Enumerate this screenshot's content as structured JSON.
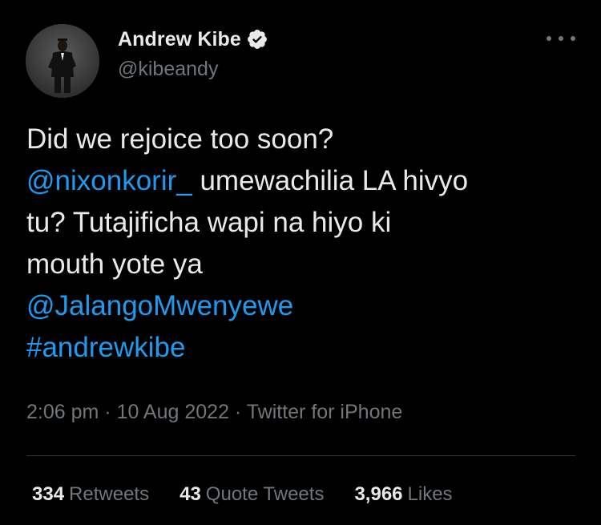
{
  "tweet": {
    "author": {
      "display_name": "Andrew Kibe",
      "handle": "@kibeandy",
      "verified_icon": "verified-badge-icon",
      "avatar": "profile-photo"
    },
    "more_icon": "more-options-icon",
    "text_lines": [
      [
        {
          "t": "Did we rejoice too soon?",
          "link": false
        }
      ],
      [
        {
          "t": "@nixonkorir_",
          "link": true
        },
        {
          "t": " umewachilia LA hivyo",
          "link": false
        }
      ],
      [
        {
          "t": "tu? Tutajificha wapi na hiyo ki",
          "link": false
        }
      ],
      [
        {
          "t": "mouth yote ya",
          "link": false
        }
      ],
      [
        {
          "t": "@JalangoMwenyewe",
          "link": true
        }
      ],
      [
        {
          "t": "#andrewkibe",
          "link": true
        }
      ]
    ],
    "meta": {
      "time": "2:06 pm",
      "separator": " · ",
      "date": "10 Aug 2022",
      "client": "Twitter for iPhone"
    },
    "stats": {
      "retweets_count": "334",
      "retweets_label": "Retweets",
      "quote_count": "43",
      "quote_label": "Quote Tweets",
      "likes_count": "3,966",
      "likes_label": "Likes"
    },
    "colors": {
      "background": "#000000",
      "text": "#e7e9ea",
      "secondary": "#71767b",
      "link": "#1d9bf0",
      "divider": "#2f3336"
    }
  }
}
